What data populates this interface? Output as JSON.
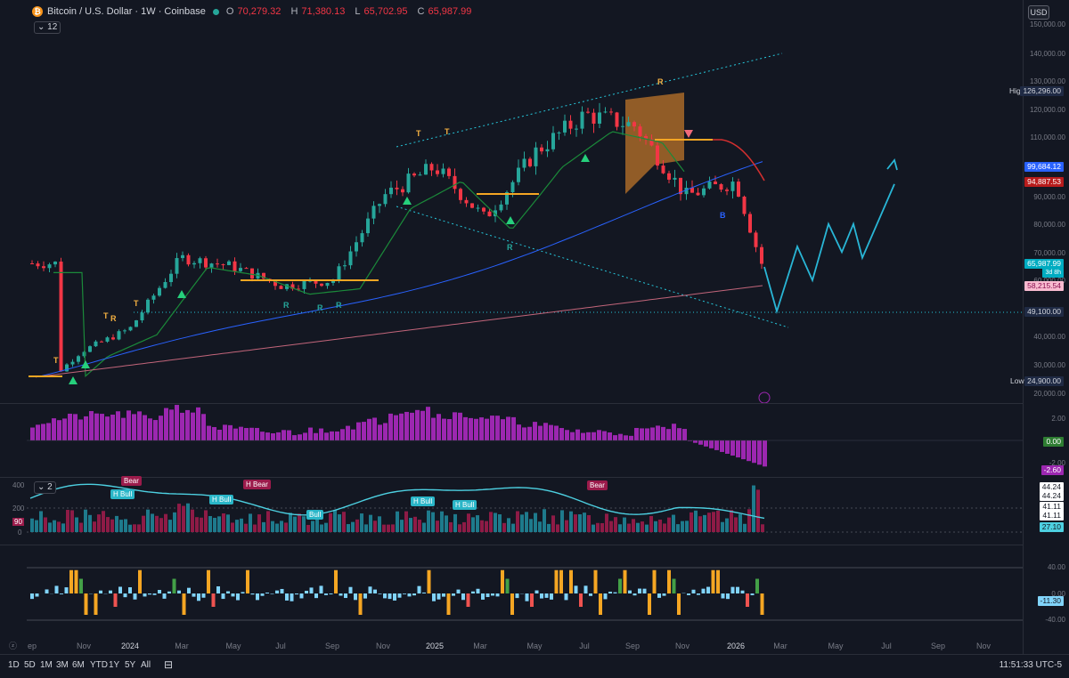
{
  "header": {
    "symbol_title": "Bitcoin / U.S. Dollar · 1W · Coinbase",
    "open_k": "O",
    "open": "70,279.32",
    "high_k": "H",
    "high": "71,380.13",
    "low_k": "L",
    "low": "65,702.95",
    "close_k": "C",
    "close": "65,987.99",
    "indicator_count": "12",
    "currency": "USD"
  },
  "price_axis": [
    "150,000.00",
    "140,000.00",
    "130,000.00",
    "120,000.00",
    "110,000.00",
    "90,000.00",
    "80,000.00",
    "70,000.00",
    "60,000.00",
    "40,000.00",
    "30,000.00",
    "20,000.00"
  ],
  "price_tags": {
    "high_caption": "High",
    "high_value": "126,296.00",
    "ma1": "99,684.12",
    "ma2": "94,887.53",
    "last": "65,987.99",
    "last_sub": "3d 8h",
    "ma3": "58,215.54",
    "level": "49,100.00",
    "low_caption": "Low",
    "low_value": "24,900.00"
  },
  "macd_pane": {
    "ticks": [
      "2.00",
      "-2.00"
    ],
    "tag_zero": "0.00",
    "tag_value": "-2.60"
  },
  "vol_pane": {
    "count_label": "2",
    "ticks": [
      "400",
      "200",
      "0"
    ],
    "left_tag": "90",
    "tags": [
      "44.24",
      "44.24",
      "41.11",
      "41.11",
      "27.10"
    ]
  },
  "osc_pane": {
    "ticks": [
      "40.00",
      "0.00",
      "-40.00"
    ],
    "tag_value": "-11.30"
  },
  "markers": {
    "bear": "Bear",
    "h_bull": "H Bull",
    "h_bear": "H Bear",
    "bull": "Bull"
  },
  "letters": {
    "t": "T",
    "r": "R",
    "b": "B"
  },
  "time_axis": [
    "ep",
    "Nov",
    "2024",
    "Mar",
    "May",
    "Jul",
    "Sep",
    "Nov",
    "2025",
    "Mar",
    "May",
    "Jul",
    "Sep",
    "Nov",
    "2026",
    "Mar",
    "May",
    "Jul",
    "Sep",
    "Nov"
  ],
  "ranges": [
    "1D",
    "5D",
    "1M",
    "3M",
    "6M",
    "YTD",
    "1Y",
    "5Y",
    "All"
  ],
  "clock": "11:51:33 UTC-5",
  "colors": {
    "up": "#26a69a",
    "down": "#f23645",
    "macd": "#9c27b0",
    "rsi_line": "#4dd0e1",
    "projection": "#29b6d6",
    "ma_green": "#1b8a3a",
    "ma_blue": "#2962ff",
    "ma_red": "#d32f2f",
    "ma_pink": "#c2657a"
  },
  "chart_data": {
    "type": "line",
    "title": "Bitcoin / U.S. Dollar · 1W · Coinbase",
    "x": [
      "2023-10",
      "2023-11",
      "2024-01",
      "2024-03",
      "2024-05",
      "2024-07",
      "2024-09",
      "2024-11",
      "2025-01",
      "2025-03",
      "2025-05",
      "2025-07",
      "2025-09",
      "2025-11",
      "2026-01",
      "2026-02"
    ],
    "series": [
      {
        "values": [
          27000,
          35000,
          43000,
          68000,
          65000,
          58000,
          60000,
          90000,
          100000,
          82000,
          105000,
          118000,
          114000,
          90000,
          95000,
          66000
        ]
      }
    ],
    "projection": [
      49100,
      72000,
      60000,
      80000,
      70000,
      80000,
      68000,
      94000
    ],
    "ylim": [
      20000,
      150000
    ]
  }
}
